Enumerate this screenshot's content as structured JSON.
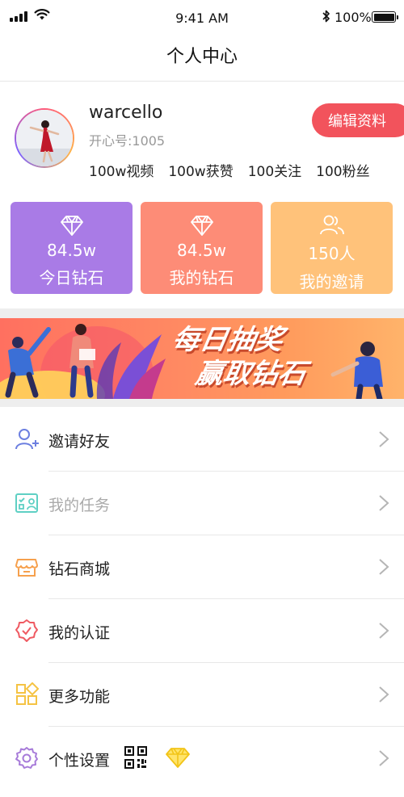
{
  "status_bar": {
    "time": "9:41 AM",
    "battery": "100%"
  },
  "nav": {
    "title": "个人中心"
  },
  "profile": {
    "username": "warcello",
    "user_id": "开心号:1005",
    "edit_label": "编辑资料",
    "stats": [
      {
        "label": "100w视频"
      },
      {
        "label": "100w获赞"
      },
      {
        "label": "100关注"
      },
      {
        "label": "100粉丝"
      }
    ]
  },
  "cards": [
    {
      "icon": "diamond-icon",
      "value": "84.5w",
      "label": "今日钻石",
      "color": "#a97be6"
    },
    {
      "icon": "diamond-icon",
      "value": "84.5w",
      "label": "我的钻石",
      "color": "#fd8c77"
    },
    {
      "icon": "users-icon",
      "value": "150人",
      "label": "我的邀请",
      "color": "#ffc27a"
    }
  ],
  "banner": {
    "line1": "每日抽奖",
    "line2": "赢取钻石"
  },
  "menu": [
    {
      "icon": "add-user-icon",
      "label": "邀请好友",
      "muted": false
    },
    {
      "icon": "task-icon",
      "label": "我的任务",
      "muted": true
    },
    {
      "icon": "store-icon",
      "label": "钻石商城",
      "muted": false
    },
    {
      "icon": "verified-badge-icon",
      "label": "我的认证",
      "muted": false
    },
    {
      "icon": "grid-icon",
      "label": "更多功能",
      "muted": false
    },
    {
      "icon": "settings-icon",
      "label": "个性设置",
      "muted": false
    }
  ],
  "colors": {
    "accent_red": "#f2535c",
    "menu_icon_blue": "#6c7fe0",
    "menu_icon_teal": "#5fd0c4",
    "menu_icon_orange": "#f6a04d",
    "menu_icon_red": "#ef5a62",
    "menu_icon_yellow": "#f5c343",
    "menu_icon_purple": "#a77bd9"
  }
}
